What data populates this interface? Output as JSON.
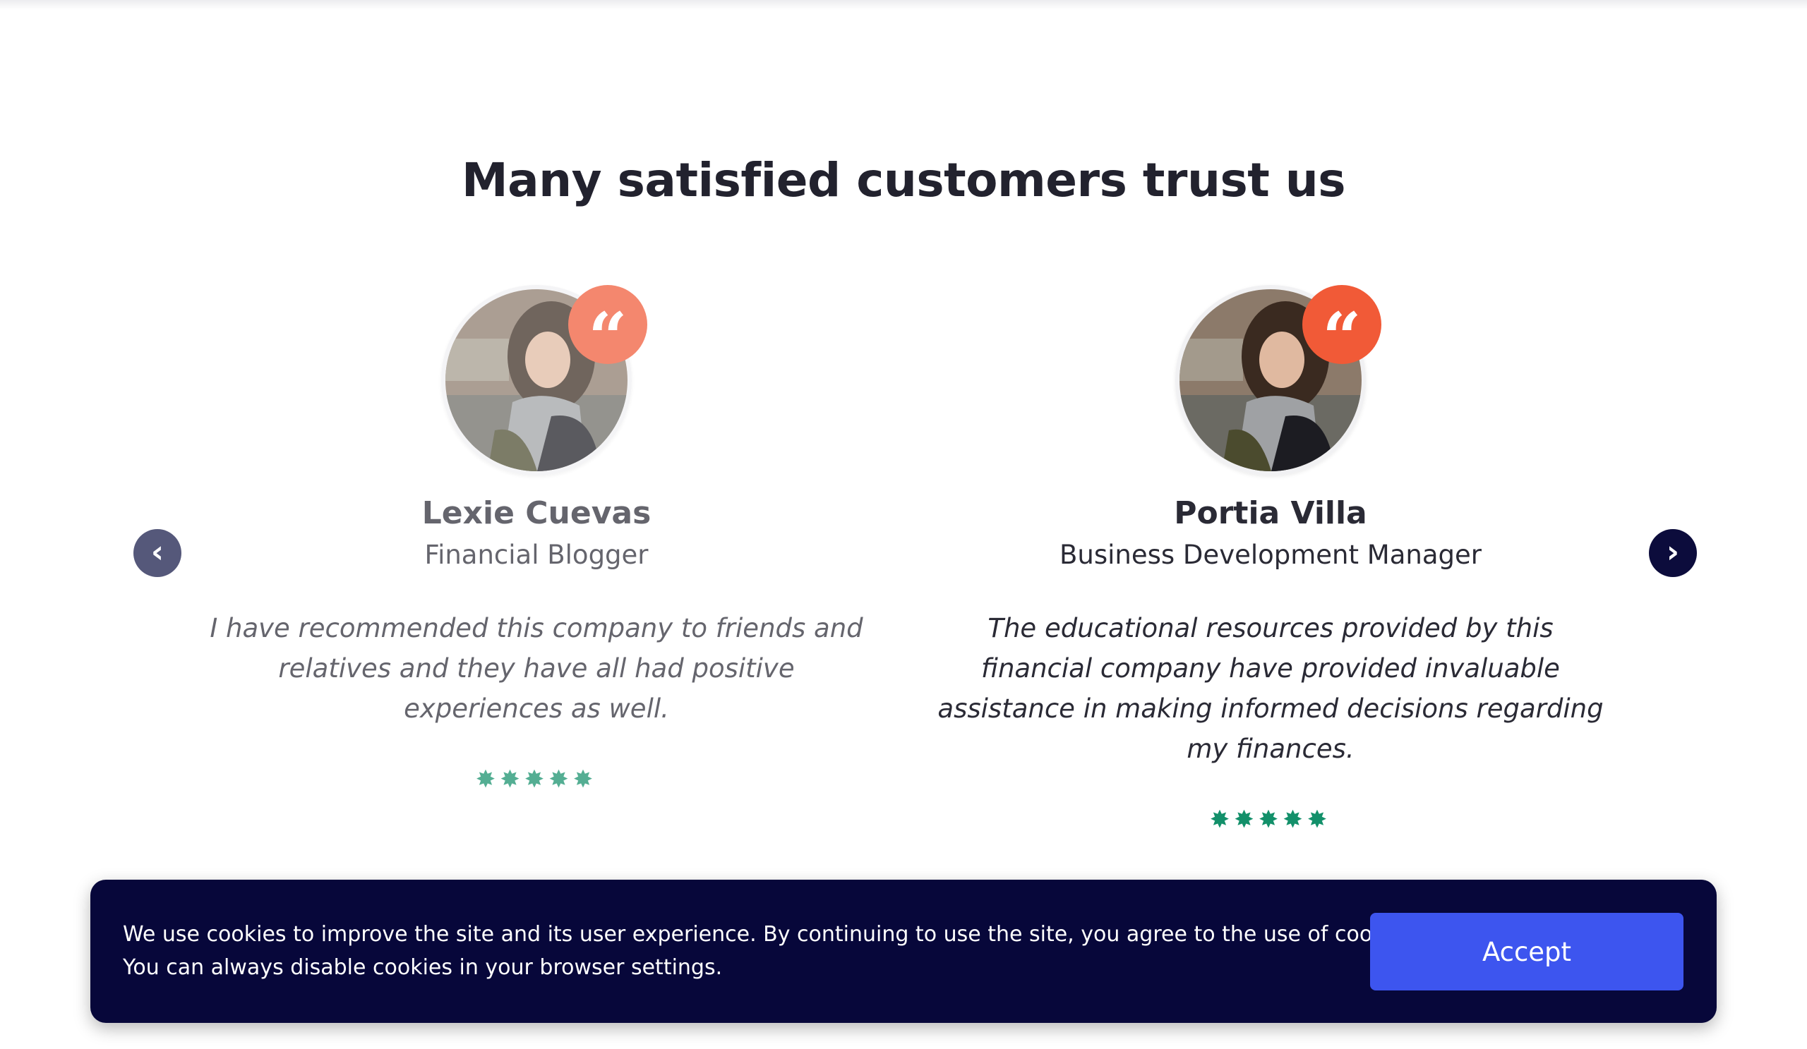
{
  "section": {
    "title": "Many satisfied customers trust us"
  },
  "testimonials": [
    {
      "name": "Lexie Cuevas",
      "role": "Financial Blogger",
      "quote": "I have recommended this company to friends and relatives and they have all had positive experiences as well.",
      "rating": 5,
      "stars": "✸✸✸✸✸",
      "quote_icon": "“"
    },
    {
      "name": "Portia Villa",
      "role": "Business Development Manager",
      "quote": "The educational resources provided by this financial company have provided invaluable assistance in making informed decisions regarding my finances.",
      "rating": 5,
      "stars": "✸✸✸✸✸",
      "quote_icon": "“"
    }
  ],
  "carousel": {
    "prev_icon": "‹",
    "next_icon": "›",
    "prev_icon_name": "chevron-left-icon",
    "next_icon_name": "chevron-right-icon"
  },
  "cookie_banner": {
    "message": "We use cookies to improve the site and its user experience. By continuing to use the site, you agree to the use of cookies. You can always disable cookies in your browser settings.",
    "accept_label": "Accept"
  },
  "colors": {
    "accent_orange": "#f15a37",
    "star_green": "#13906a",
    "banner_navy": "#07073a",
    "button_blue": "#3d55ef",
    "arrow_dark": "#0c0c3c"
  }
}
